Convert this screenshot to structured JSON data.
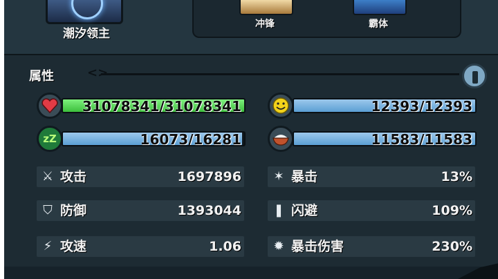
{
  "hero": {
    "name": "潮汐领主"
  },
  "skills": [
    {
      "label": "冲锋",
      "icon": "charge-skill-icon"
    },
    {
      "label": "霸体",
      "icon": "super-armor-skill-icon"
    }
  ],
  "attributes": {
    "title": "属性",
    "bars": {
      "hp": {
        "text": "31078341/31078341",
        "fill": 1.0,
        "color": "#4cd64c",
        "icon": "heart-icon"
      },
      "sleep": {
        "text": "16073/16281",
        "fill": 0.987,
        "color": "#6aa9d8",
        "icon": "zzz-icon"
      },
      "mood": {
        "text": "12393/12393",
        "fill": 1.0,
        "color": "#6aa9d8",
        "icon": "smiley-icon"
      },
      "food": {
        "text": "11583/11583",
        "fill": 1.0,
        "color": "#6aa9d8",
        "icon": "food-bowl-icon"
      }
    },
    "stats": {
      "attack": {
        "label": "攻击",
        "value": "1697896",
        "icon": "crossed-swords-icon"
      },
      "defense": {
        "label": "防御",
        "value": "1393044",
        "icon": "shield-icon"
      },
      "attack_speed": {
        "label": "攻速",
        "value": "1.06",
        "icon": "sword-speed-icon"
      },
      "crit": {
        "label": "暴击",
        "value": "13%",
        "icon": "crit-burst-icon"
      },
      "dodge": {
        "label": "闪避",
        "value": "109%",
        "icon": "dodge-icon"
      },
      "crit_damage": {
        "label": "暴击伤害",
        "value": "230%",
        "icon": "crit-damage-icon"
      }
    }
  }
}
